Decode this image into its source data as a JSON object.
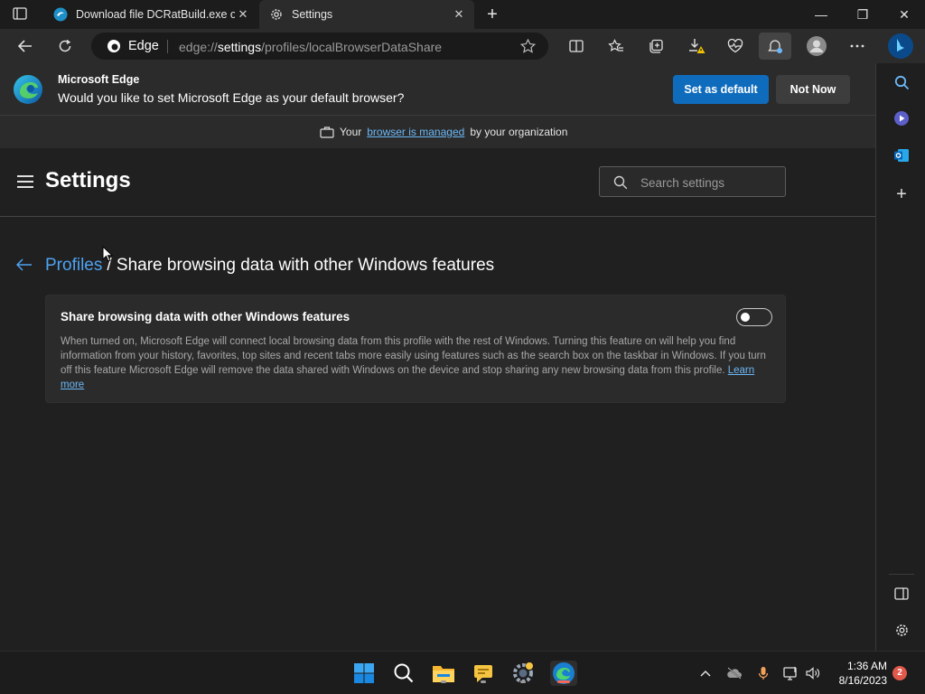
{
  "tabs": [
    {
      "title": "Download file DCRatBuild.exe on",
      "active": false
    },
    {
      "title": "Settings",
      "active": true
    }
  ],
  "toolbar": {
    "site_label": "Edge",
    "url_prefix": "edge://",
    "url_host": "settings",
    "url_path": "/profiles/localBrowserDataShare"
  },
  "banner": {
    "app_name": "Microsoft Edge",
    "question": "Would you like to set Microsoft Edge as your default browser?",
    "primary_btn": "Set as default",
    "secondary_btn": "Not Now"
  },
  "managed": {
    "prefix": "Your",
    "link": "browser is managed",
    "suffix": "by your organization"
  },
  "settings": {
    "title": "Settings",
    "search_placeholder": "Search settings"
  },
  "breadcrumb": {
    "parent": "Profiles",
    "current": "/ Share browsing data with other Windows features"
  },
  "card": {
    "title": "Share browsing data with other Windows features",
    "description": "When turned on, Microsoft Edge will connect local browsing data from this profile with the rest of Windows. Turning this feature on will help you find information from your history, favorites, top sites and recent tabs more easily using features such as the search box on the taskbar in Windows. If you turn off this feature Microsoft Edge will remove the data shared with Windows on the device and stop sharing any new browsing data from this profile.",
    "learn_more": "Learn more",
    "toggle_on": false
  },
  "taskbar": {
    "time": "1:36 AM",
    "date": "8/16/2023",
    "notification_count": "2"
  },
  "colors": {
    "accent": "#0f6cbd",
    "link": "#4da3f0",
    "background": "#202020"
  }
}
